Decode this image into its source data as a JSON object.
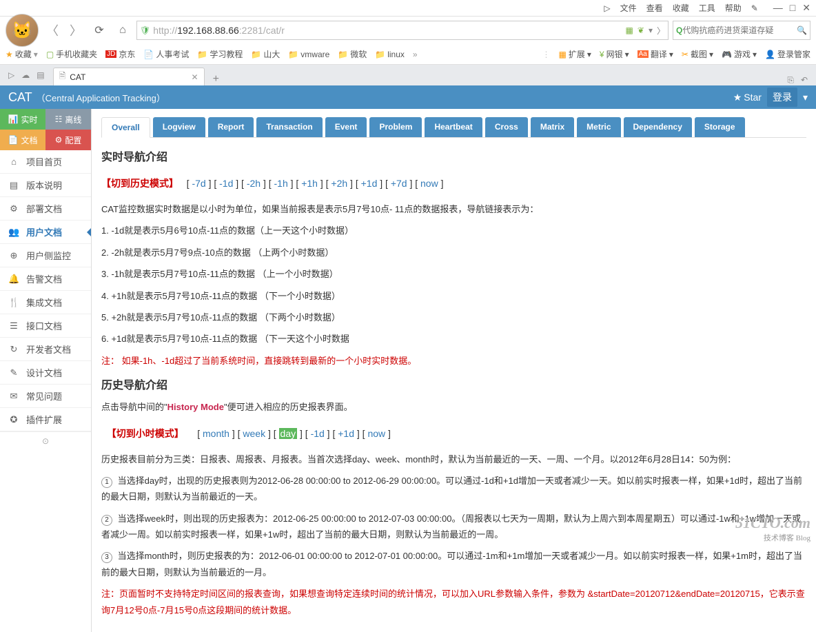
{
  "menuBar": {
    "items": [
      "文件",
      "查看",
      "收藏",
      "工具",
      "帮助"
    ]
  },
  "url": {
    "protocol": "http://",
    "host": "192.168.88.66",
    "port": ":2281",
    "path": "/cat/r"
  },
  "searchPlaceholder": "代购抗癌药进货渠道存疑",
  "bookmarks": {
    "fav": "收藏",
    "items": [
      "手机收藏夹",
      "京东",
      "人事考试",
      "学习教程",
      "山大",
      "vmware",
      "微软",
      "linux"
    ],
    "right": [
      "扩展",
      "网银",
      "翻译",
      "截图",
      "游戏",
      "登录管家"
    ]
  },
  "tab": {
    "title": "CAT"
  },
  "cat": {
    "title": "CAT",
    "subtitle": "（Central Application Tracking）",
    "star": "Star",
    "login": "登录"
  },
  "sideBtns": {
    "realtime": "实时",
    "offline": "离线",
    "doc": "文档",
    "config": "配置"
  },
  "sideMenu": [
    "项目首页",
    "版本说明",
    "部署文档",
    "用户文档",
    "用户侧监控",
    "告警文档",
    "集成文档",
    "接口文档",
    "开发者文档",
    "设计文档",
    "常见问题",
    "插件扩展"
  ],
  "sideMenuActive": 3,
  "tabsNav": [
    "Overall",
    "Logview",
    "Report",
    "Transaction",
    "Event",
    "Problem",
    "Heartbeat",
    "Cross",
    "Matrix",
    "Metric",
    "Dependency",
    "Storage"
  ],
  "section1": {
    "title": "实时导航介绍",
    "modeLabel": "【切到历史模式】",
    "links": [
      "-7d",
      "-1d",
      "-2h",
      "-1h",
      "+1h",
      "+2h",
      "+1d",
      "+7d",
      "now"
    ],
    "intro": "CAT监控数据实时数据是以小时为单位，如果当前报表是表示5月7号10点- 11点的数据报表，导航链接表示为：",
    "lines": [
      "1. -1d就是表示5月6号10点-11点的数据（上一天这个小时数据）",
      "2. -2h就是表示5月7号9点-10点的数据 （上两个小时数据）",
      "3. -1h就是表示5月7号10点-11点的数据 （上一个小时数据）",
      "4. +1h就是表示5月7号10点-11点的数据 （下一个小时数据）",
      "5. +2h就是表示5月7号10点-11点的数据 （下两个小时数据）",
      "6. +1d就是表示5月7号10点-11点的数据 （下一天这个小时数据"
    ],
    "note": "注： 如果-1h、-1d超过了当前系统时间，直接跳转到最新的一个小时实时数据。"
  },
  "section2": {
    "title": "历史导航介绍",
    "introPrefix": "点击导航中间的\"",
    "historyMode": "History Mode",
    "introSuffix": "\"便可进入相应的历史报表界面。",
    "modeLabel": "【切到小时模式】",
    "links": [
      "month",
      "week",
      "day",
      "-1d",
      "+1d",
      "now"
    ],
    "highlightIndex": 2,
    "para0": "历史报表目前分为三类：日报表、周报表、月报表。当首次选择day、week、month时，默认为当前最近的一天、一周、一个月。以2012年6月28日14：50为例：",
    "para1": "当选择day时，出现的历史报表则为2012-06-28 00:00:00 to 2012-06-29 00:00:00。可以通过-1d和+1d增加一天或者减少一天。如以前实时报表一样，如果+1d时，超出了当前的最大日期，则默认为当前最近的一天。",
    "para2": "当选择week时，则出现的历史报表为：2012-06-25 00:00:00 to 2012-07-03 00:00:00。（周报表以七天为一周期，默认为上周六到本周星期五）可以通过-1w和+1w增加一天或者减少一周。如以前实时报表一样，如果+1w时，超出了当前的最大日期，则默认为当前最近的一周。",
    "para3": "当选择month时，则历史报表的为：2012-06-01 00:00:00 to 2012-07-01 00:00:00。可以通过-1m和+1m增加一天或者减少一月。如以前实时报表一样，如果+1m时，超出了当前的最大日期，则默认为当前最近的一月。",
    "note": "注：页面暂时不支持特定时间区间的报表查询，如果想查询特定连续时间的统计情况，可以加入URL参数输入条件，参数为 &startDate=20120712&endDate=20120715，它表示查询7月12号0点-7月15号0点这段期间的统计数据。"
  },
  "watermark": {
    "big": "51CTO.com",
    "small": "技术博客 Blog"
  }
}
